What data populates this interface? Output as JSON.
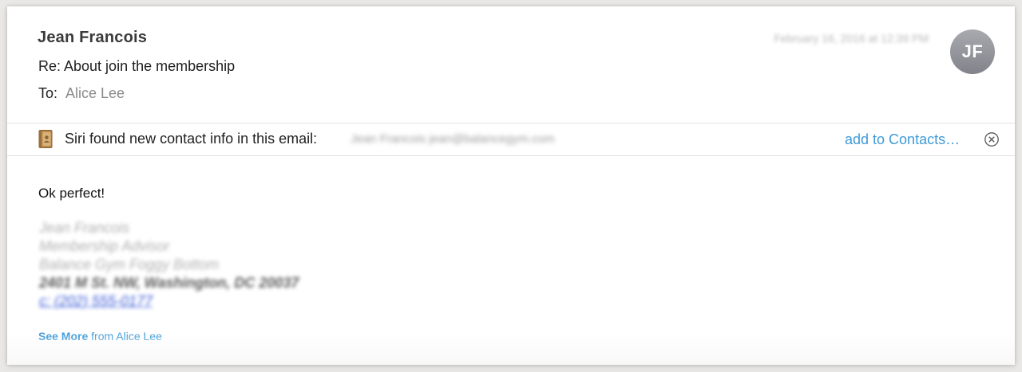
{
  "email": {
    "sender_name": "Jean Francois",
    "subject": "Re: About join the membership",
    "to_label": "To:",
    "to_recipient": "Alice Lee",
    "date": "February 16, 2016 at 12:39 PM",
    "avatar_initials": "JF"
  },
  "siri": {
    "icon": "contacts-book-icon",
    "text": "Siri found new contact info in this email:",
    "found_info": "Jean Francois jean@balancegym.com",
    "add_link": "add to Contacts…",
    "dismiss_icon": "close-circle-icon"
  },
  "body": {
    "message": "Ok perfect!",
    "signature": [
      "Jean Francois",
      "Membership Advisor",
      "Balance Gym Foggy Bottom",
      "2401 M St. NW, Washington, DC 20037",
      "c: (202) 555-0177"
    ],
    "see_more_bold": "See More",
    "see_more_rest": " from Alice Lee"
  },
  "colors": {
    "accent": "#3e9ad7",
    "avatar": "#8e8f96"
  }
}
